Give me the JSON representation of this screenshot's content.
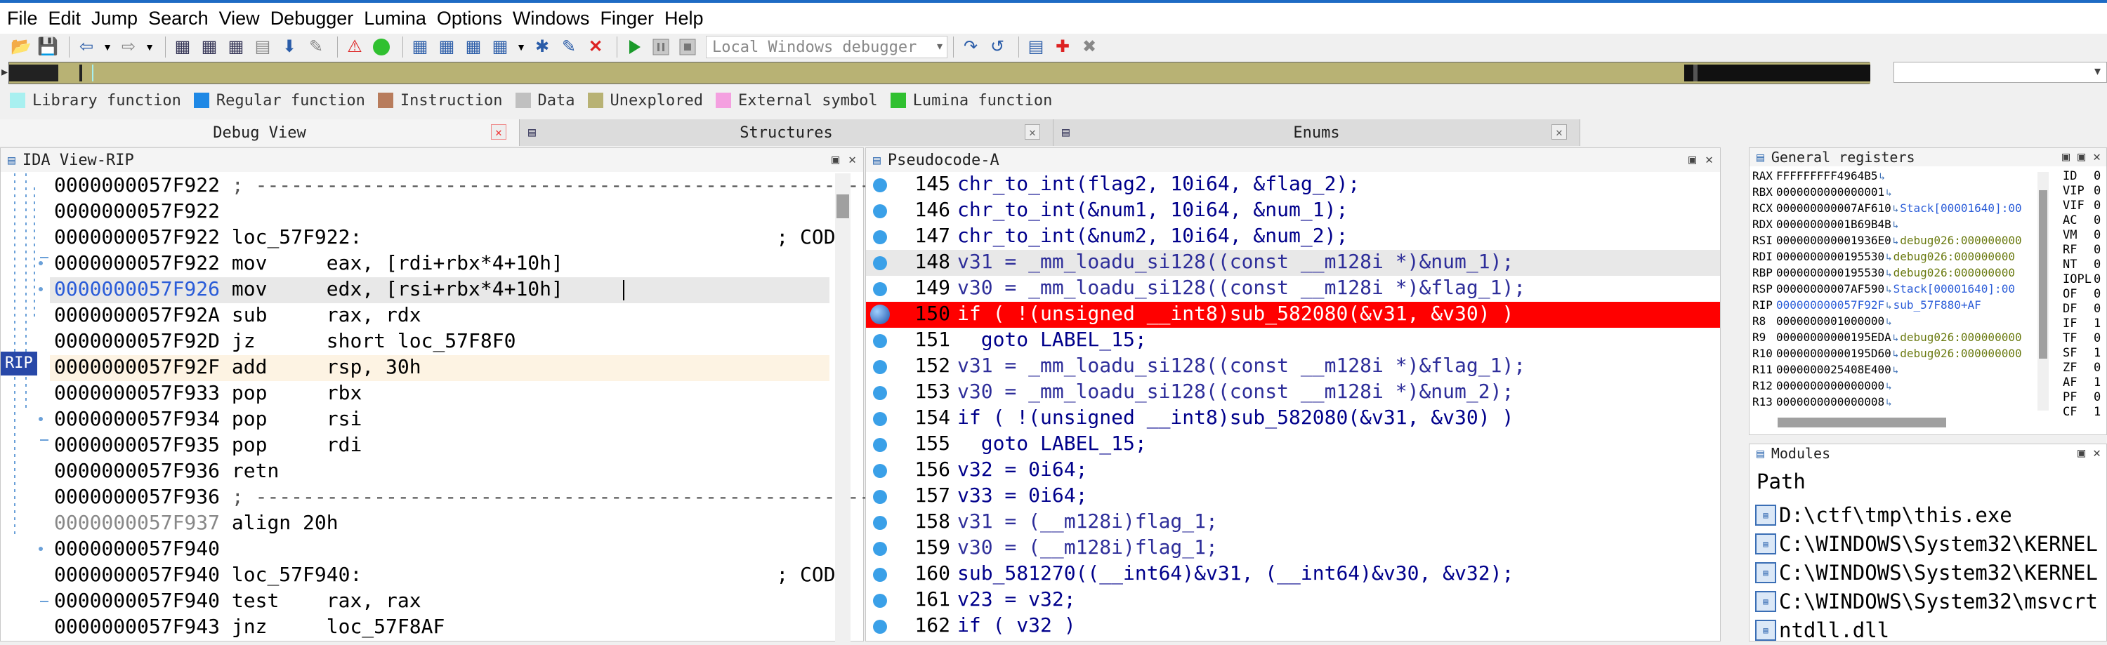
{
  "menu": [
    "File",
    "Edit",
    "Jump",
    "Search",
    "View",
    "Debugger",
    "Lumina",
    "Options",
    "Windows",
    "Finger",
    "Help"
  ],
  "toolbar": {
    "debugger_select": "Local Windows debugger"
  },
  "legend": [
    {
      "label": "Library function",
      "color": "#a8f0f0"
    },
    {
      "label": "Regular function",
      "color": "#1e88e5"
    },
    {
      "label": "Instruction",
      "color": "#b87c5c"
    },
    {
      "label": "Data",
      "color": "#c0c0c0"
    },
    {
      "label": "Unexplored",
      "color": "#b8b274"
    },
    {
      "label": "External symbol",
      "color": "#f4a0e0"
    },
    {
      "label": "Lumina function",
      "color": "#30c030"
    }
  ],
  "tabs": [
    {
      "label": "Debug View"
    },
    {
      "label": "Structures"
    },
    {
      "label": "Enums"
    }
  ],
  "ida": {
    "title": "IDA View-RIP",
    "rip_label": "RIP",
    "lines": [
      {
        "addr": "0000000057F922",
        "text": " ; ---------------------------------------------------------------------------",
        "color": "#555"
      },
      {
        "addr": "0000000057F922",
        "text": "",
        "color": "#000"
      },
      {
        "addr": "0000000057F922",
        "text": " loc_57F922:                                   ; CODE",
        "color": "#000"
      },
      {
        "addr": "0000000057F922",
        "text": " mov     eax, [rdi+rbx*4+10h]",
        "color": "#000"
      },
      {
        "addr": "0000000057F926",
        "text": " mov     edx, [rsi+rbx*4+10h]",
        "color": "#000"
      },
      {
        "addr": "0000000057F92A",
        "text": " sub     rax, rdx",
        "color": "#000"
      },
      {
        "addr": "0000000057F92D",
        "text": " jz      short loc_57F8F0",
        "color": "#000"
      },
      {
        "addr": "0000000057F92F",
        "text": " add     rsp, 30h",
        "color": "#000"
      },
      {
        "addr": "0000000057F933",
        "text": " pop     rbx",
        "color": "#000"
      },
      {
        "addr": "0000000057F934",
        "text": " pop     rsi",
        "color": "#000"
      },
      {
        "addr": "0000000057F935",
        "text": " pop     rdi",
        "color": "#000"
      },
      {
        "addr": "0000000057F936",
        "text": " retn",
        "color": "#000"
      },
      {
        "addr": "0000000057F936",
        "text": " ; ---------------------------------------------------------------------------",
        "color": "#555"
      },
      {
        "addr": "0000000057F937",
        "text": " align 20h",
        "color": "#000"
      },
      {
        "addr": "0000000057F940",
        "text": "",
        "color": "#000"
      },
      {
        "addr": "0000000057F940",
        "text": " loc_57F940:                                   ; CODE",
        "color": "#000"
      },
      {
        "addr": "0000000057F940",
        "text": " test    rax, rax",
        "color": "#000"
      },
      {
        "addr": "0000000057F943",
        "text": " jnz     loc_57F8AF",
        "color": "#000"
      }
    ]
  },
  "pseudo": {
    "title": "Pseudocode-A",
    "lines": [
      {
        "num": "145",
        "code": "chr_to_int(flag2, 10i64, &flag_2);"
      },
      {
        "num": "146",
        "code": "chr_to_int(&num1, 10i64, &num_1);"
      },
      {
        "num": "147",
        "code": "chr_to_int(&num2, 10i64, &num_2);"
      },
      {
        "num": "148",
        "code": "v31 = _mm_loadu_si128((const __m128i *)&num_1);"
      },
      {
        "num": "149",
        "code": "v30 = _mm_loadu_si128((const __m128i *)&flag_1);"
      },
      {
        "num": "150",
        "code": "if ( !(unsigned __int8)sub_582080(&v31, &v30) )"
      },
      {
        "num": "151",
        "code": "  goto LABEL_15;"
      },
      {
        "num": "152",
        "code": "v31 = _mm_loadu_si128((const __m128i *)&flag_1);"
      },
      {
        "num": "153",
        "code": "v30 = _mm_loadu_si128((const __m128i *)&num_2);"
      },
      {
        "num": "154",
        "code": "if ( !(unsigned __int8)sub_582080(&v31, &v30) )"
      },
      {
        "num": "155",
        "code": "  goto LABEL_15;"
      },
      {
        "num": "156",
        "code": "v32 = 0i64;"
      },
      {
        "num": "157",
        "code": "v33 = 0i64;"
      },
      {
        "num": "158",
        "code": "v31 = (__m128i)flag_1;"
      },
      {
        "num": "159",
        "code": "v30 = (__m128i)flag_1;"
      },
      {
        "num": "160",
        "code": "sub_581270((__int64)&v31, (__int64)&v30, &v32);"
      },
      {
        "num": "161",
        "code": "v23 = v32;"
      },
      {
        "num": "162",
        "code": "if ( v32 )"
      }
    ]
  },
  "registers": {
    "title": "General registers",
    "rows": [
      {
        "name": "RAX",
        "value": "FFFFFFFFF4964B5",
        "comment": ""
      },
      {
        "name": "RBX",
        "value": "0000000000000001",
        "comment": ""
      },
      {
        "name": "RCX",
        "value": "000000000007AF610",
        "comment": "Stack[00001640]:00"
      },
      {
        "name": "RDX",
        "value": "00000000001B69B4B",
        "comment": ""
      },
      {
        "name": "RSI",
        "value": "000000000001936E0",
        "comment": "debug026:000000000"
      },
      {
        "name": "RDI",
        "value": "0000000000195530",
        "comment": "debug026:000000000"
      },
      {
        "name": "RBP",
        "value": "0000000000195530",
        "comment": "debug026:000000000"
      },
      {
        "name": "RSP",
        "value": "00000000007AF590",
        "comment": "Stack[00001640]:00"
      },
      {
        "name": "RIP",
        "value": "000000000057F92F",
        "comment": "sub_57F880+AF"
      },
      {
        "name": "R8",
        "value": "0000000001000000",
        "comment": ""
      },
      {
        "name": "R9",
        "value": "00000000000195EDA",
        "comment": "debug026:000000000"
      },
      {
        "name": "R10",
        "value": "00000000000195D60",
        "comment": "debug026:000000000"
      },
      {
        "name": "R11",
        "value": "0000000025408E400",
        "comment": ""
      },
      {
        "name": "R12",
        "value": "0000000000000000",
        "comment": ""
      },
      {
        "name": "R13",
        "value": "0000000000000008",
        "comment": ""
      }
    ],
    "flags": [
      {
        "name": "ID",
        "value": "0"
      },
      {
        "name": "VIP",
        "value": "0"
      },
      {
        "name": "VIF",
        "value": "0"
      },
      {
        "name": "AC",
        "value": "0"
      },
      {
        "name": "VM",
        "value": "0"
      },
      {
        "name": "RF",
        "value": "0"
      },
      {
        "name": "NT",
        "value": "0"
      },
      {
        "name": "IOPL",
        "value": "0"
      },
      {
        "name": "OF",
        "value": "0"
      },
      {
        "name": "DF",
        "value": "0"
      },
      {
        "name": "IF",
        "value": "1"
      },
      {
        "name": "TF",
        "value": "0"
      },
      {
        "name": "SF",
        "value": "1"
      },
      {
        "name": "ZF",
        "value": "0"
      },
      {
        "name": "AF",
        "value": "1"
      },
      {
        "name": "PF",
        "value": "0"
      },
      {
        "name": "CF",
        "value": "1"
      }
    ]
  },
  "modules": {
    "title": "Modules",
    "header": "Path",
    "items": [
      "D:\\ctf\\tmp\\this.exe",
      "C:\\WINDOWS\\System32\\KERNEL",
      "C:\\WINDOWS\\System32\\KERNEL",
      "C:\\WINDOWS\\System32\\msvcrt",
      "ntdll.dll"
    ]
  },
  "colors": {
    "accent": "#1e6bc4",
    "breakpoint": "#ff0000",
    "current_line": "#fdf3e3",
    "selected_line": "#e8e8e8",
    "keyword": "#00008b",
    "variable": "#5050c0",
    "number": "#007000"
  }
}
